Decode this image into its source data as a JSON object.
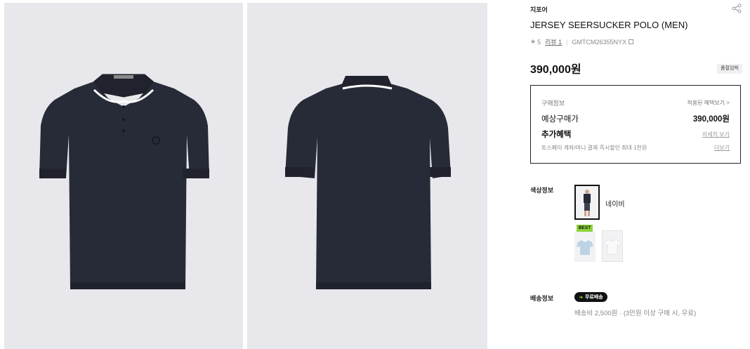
{
  "product": {
    "brand": "지포어",
    "title": "JERSEY SEERSUCKER POLO (MEN)",
    "rating": "5",
    "review_label": "리뷰 1",
    "code": "GMTCM26355NYX",
    "price": "390,000원",
    "stock_button": "품절임박"
  },
  "purchase_info": {
    "label": "구매정보",
    "applied_benefits_link": "적용된 혜택보기 >",
    "expected_price_label": "예상구매가",
    "expected_price": "390,000원",
    "extra_benefit_label": "추가혜택",
    "detail_link": "자세히 보기",
    "tosspay_text": "토스페이 계좌/머니 결제 즉시할인 최대 1천원",
    "more_link": "더보기"
  },
  "color_info": {
    "label": "색상정보",
    "selected_color": "네이비",
    "best_badge": "BEST"
  },
  "shipping_info": {
    "label": "배송정보",
    "free_badge": "무료배송",
    "detail": "배송비 2,500원 · (3만원 이상 구매 시, 무료)"
  },
  "colors": {
    "background_gray": "#e8e8ec",
    "shirt_navy": "#272b37",
    "best_green": "#8cd33a",
    "swatch_light_blue": "#bcd3e6"
  },
  "icons": [
    "share-icon",
    "star-icon",
    "copy-icon",
    "leaf-icon"
  ]
}
